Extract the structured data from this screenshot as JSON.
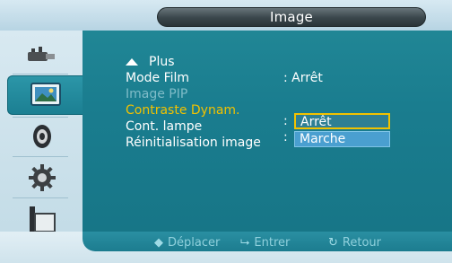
{
  "title": "Image",
  "menu": {
    "more": "Plus",
    "items": [
      {
        "label": "Mode Film",
        "value": ": Arrêt"
      },
      {
        "label": "Image PIP",
        "value": ""
      },
      {
        "label": "Contraste Dynam.",
        "value": ":"
      },
      {
        "label": "Cont. lampe",
        "value": ":"
      },
      {
        "label": "Réinitialisation image",
        "value": ""
      }
    ]
  },
  "dropdown": {
    "options": [
      "Arrêt",
      "Marche"
    ],
    "selected": "Arrêt"
  },
  "nav": {
    "move": "Déplacer",
    "enter": "Entrer",
    "back": "Retour"
  },
  "icons": {
    "rail": [
      "input-source-icon",
      "picture-icon",
      "sound-icon",
      "settings-gear-icon",
      "multi-screen-icon"
    ],
    "nav": [
      "up-down-arrows-icon",
      "enter-icon",
      "return-icon"
    ]
  },
  "colors": {
    "panel": "#1a7d8f",
    "highlight_text": "#f2c200",
    "disabled_text": "#7fbcc8"
  }
}
